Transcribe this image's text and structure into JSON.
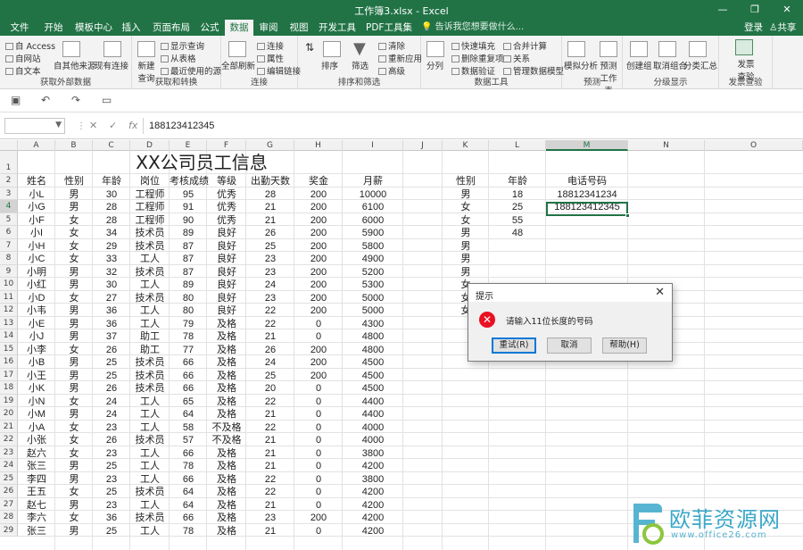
{
  "window": {
    "title": "工作簿3.xlsx - Excel",
    "controls": [
      "—",
      "❐",
      "✕"
    ]
  },
  "tabs": [
    "文件",
    "开始",
    "模板中心",
    "插入",
    "页面布局",
    "公式",
    "数据",
    "审阅",
    "视图",
    "开发工具",
    "PDF工具集"
  ],
  "active_tab": "数据",
  "tell_me": "告诉我您想要做什么...",
  "account": {
    "login": "登录",
    "share": "共享"
  },
  "ribbon": {
    "groups": [
      {
        "label": "获取外部数据",
        "items": [
          "自 Access",
          "自网站",
          "自文本",
          "自其他来源",
          "现有连接"
        ]
      },
      {
        "label": "获取和转换",
        "items": [
          "新建查询",
          "显示查询",
          "从表格",
          "最近使用的源"
        ]
      },
      {
        "label": "连接",
        "items": [
          "全部刷新",
          "连接",
          "属性",
          "编辑链接"
        ]
      },
      {
        "label": "排序和筛选",
        "items": [
          "排序",
          "筛选",
          "清除",
          "重新应用",
          "高级"
        ]
      },
      {
        "label": "数据工具",
        "items": [
          "分列",
          "快速填充",
          "删除重复项",
          "数据验证",
          "合并计算",
          "关系",
          "管理数据模型"
        ]
      },
      {
        "label": "预测",
        "items": [
          "模拟分析",
          "预测工作表"
        ]
      },
      {
        "label": "分级显示",
        "items": [
          "创建组",
          "取消组合",
          "分类汇总"
        ]
      },
      {
        "label": "发票查验",
        "items": [
          "发票查验"
        ]
      }
    ]
  },
  "formula_bar": {
    "name_box": "",
    "cancel": "✕",
    "confirm": "✓",
    "fx": "fx",
    "content": "188123412345"
  },
  "columns": [
    "A",
    "B",
    "C",
    "D",
    "E",
    "F",
    "G",
    "H",
    "I",
    "J",
    "K",
    "L",
    "M",
    "N",
    "O"
  ],
  "selected_column": "M",
  "selected_row": 4,
  "sheet": {
    "title": "XX公司员工信息",
    "headers": [
      "姓名",
      "性别",
      "年龄",
      "岗位",
      "考核成绩",
      "等级",
      "出勤天数",
      "奖金",
      "月薪"
    ],
    "rows": [
      [
        "小L",
        "男",
        "30",
        "工程师",
        "95",
        "优秀",
        "28",
        "200",
        "10000"
      ],
      [
        "小G",
        "男",
        "28",
        "工程师",
        "91",
        "优秀",
        "21",
        "200",
        "6100"
      ],
      [
        "小F",
        "女",
        "28",
        "工程师",
        "90",
        "优秀",
        "21",
        "200",
        "6000"
      ],
      [
        "小I",
        "女",
        "34",
        "技术员",
        "89",
        "良好",
        "26",
        "200",
        "5900"
      ],
      [
        "小H",
        "女",
        "29",
        "技术员",
        "87",
        "良好",
        "25",
        "200",
        "5800"
      ],
      [
        "小C",
        "女",
        "33",
        "工人",
        "87",
        "良好",
        "23",
        "200",
        "4900"
      ],
      [
        "小明",
        "男",
        "32",
        "技术员",
        "87",
        "良好",
        "23",
        "200",
        "5200"
      ],
      [
        "小红",
        "男",
        "30",
        "工人",
        "89",
        "良好",
        "24",
        "200",
        "5300"
      ],
      [
        "小D",
        "女",
        "27",
        "技术员",
        "80",
        "良好",
        "23",
        "200",
        "5000"
      ],
      [
        "小韦",
        "男",
        "36",
        "工人",
        "80",
        "良好",
        "22",
        "200",
        "5000"
      ],
      [
        "小E",
        "男",
        "36",
        "工人",
        "79",
        "及格",
        "22",
        "0",
        "4300"
      ],
      [
        "小J",
        "男",
        "37",
        "助工",
        "78",
        "及格",
        "21",
        "0",
        "4800"
      ],
      [
        "小李",
        "女",
        "26",
        "助工",
        "77",
        "及格",
        "26",
        "200",
        "4800"
      ],
      [
        "小B",
        "男",
        "25",
        "技术员",
        "66",
        "及格",
        "24",
        "200",
        "4500"
      ],
      [
        "小王",
        "男",
        "25",
        "技术员",
        "66",
        "及格",
        "25",
        "200",
        "4500"
      ],
      [
        "小K",
        "男",
        "26",
        "技术员",
        "66",
        "及格",
        "20",
        "0",
        "4500"
      ],
      [
        "小N",
        "女",
        "24",
        "工人",
        "65",
        "及格",
        "22",
        "0",
        "4400"
      ],
      [
        "小M",
        "男",
        "24",
        "工人",
        "64",
        "及格",
        "21",
        "0",
        "4400"
      ],
      [
        "小A",
        "女",
        "23",
        "工人",
        "58",
        "不及格",
        "22",
        "0",
        "4000"
      ],
      [
        "小张",
        "女",
        "26",
        "技术员",
        "57",
        "不及格",
        "21",
        "0",
        "4000"
      ],
      [
        "赵六",
        "女",
        "23",
        "工人",
        "66",
        "及格",
        "21",
        "0",
        "3800"
      ],
      [
        "张三",
        "男",
        "25",
        "工人",
        "78",
        "及格",
        "21",
        "0",
        "4200"
      ],
      [
        "李四",
        "男",
        "23",
        "工人",
        "66",
        "及格",
        "22",
        "0",
        "3800"
      ],
      [
        "王五",
        "女",
        "25",
        "技术员",
        "64",
        "及格",
        "22",
        "0",
        "4200"
      ],
      [
        "赵七",
        "男",
        "23",
        "工人",
        "64",
        "及格",
        "21",
        "0",
        "4200"
      ],
      [
        "李六",
        "女",
        "36",
        "技术员",
        "66",
        "及格",
        "23",
        "200",
        "4200"
      ],
      [
        "张三",
        "男",
        "25",
        "工人",
        "78",
        "及格",
        "21",
        "0",
        "4200"
      ]
    ],
    "side_headers": [
      "性别",
      "年龄",
      "电话号码"
    ],
    "side_rows": [
      [
        "男",
        "18",
        "18812341234"
      ],
      [
        "女",
        "25",
        "188123412345"
      ],
      [
        "女",
        "55",
        ""
      ],
      [
        "男",
        "48",
        ""
      ],
      [
        "男",
        "",
        ""
      ],
      [
        "男",
        "",
        ""
      ],
      [
        "男",
        "",
        ""
      ],
      [
        "女",
        "",
        ""
      ],
      [
        "女",
        "",
        ""
      ],
      [
        "女",
        "",
        ""
      ]
    ]
  },
  "dialog": {
    "title": "提示",
    "close": "✕",
    "message": "请输入11位长度的号码",
    "buttons": [
      "重试(R)",
      "取消",
      "帮助(H)"
    ]
  },
  "watermark": {
    "text": "欧菲资源网",
    "url": "www.office26.com"
  },
  "colors": {
    "excel_green": "#217346",
    "error_red": "#e81123",
    "watermark_blue": "#3aa8c9"
  }
}
